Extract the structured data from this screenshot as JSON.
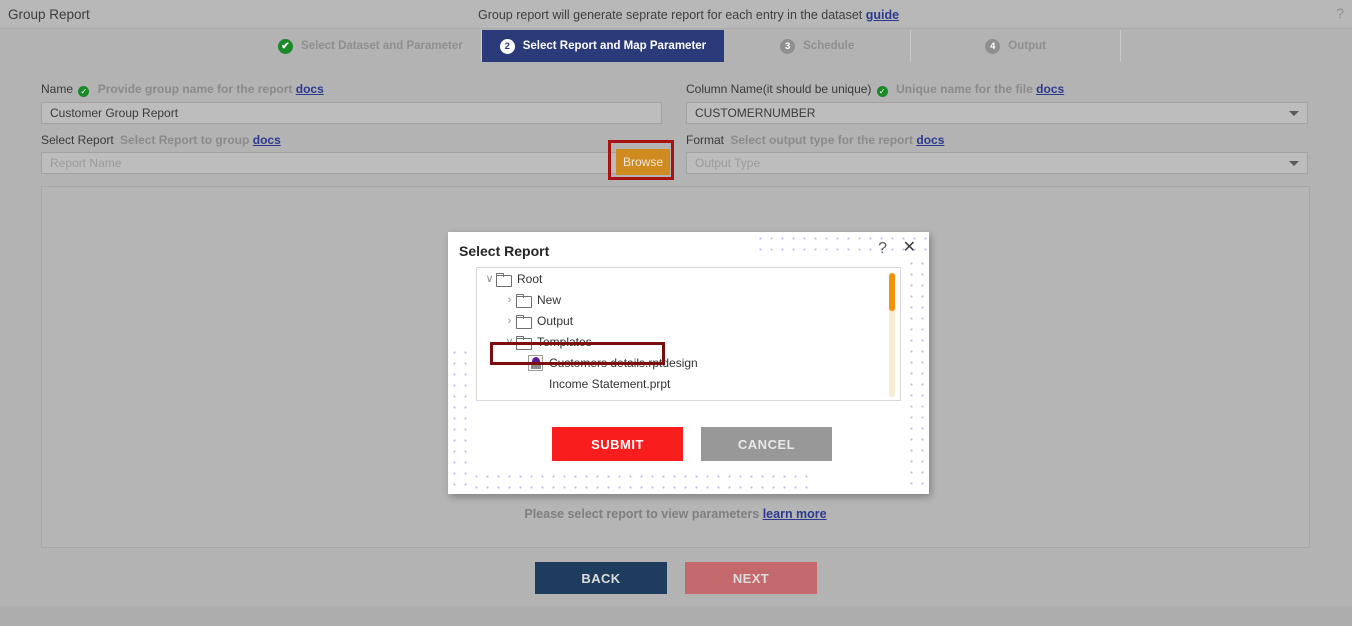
{
  "topbar": {
    "title": "Group Report",
    "center_text": "Group report will generate seprate report for each entry in the dataset",
    "center_link": "guide",
    "help_icon": "?"
  },
  "stepper": [
    {
      "badge": "✔",
      "label": "Select Dataset and Parameter",
      "state": "done"
    },
    {
      "badge": "2",
      "label": "Select Report and Map Parameter",
      "state": "active"
    },
    {
      "badge": "3",
      "label": "Schedule",
      "state": "idle"
    },
    {
      "badge": "4",
      "label": "Output",
      "state": "idle"
    }
  ],
  "form": {
    "name": {
      "label": "Name",
      "hint": "Provide group name for the report",
      "docs": "docs",
      "value": "Customer Group Report"
    },
    "select_report": {
      "label": "Select Report",
      "hint": "Select Report to group",
      "docs": "docs",
      "placeholder": "Report Name",
      "browse_label": "Browse"
    },
    "column_name": {
      "label": "Column Name(it should be unique)",
      "hint": "Unique name for the file",
      "docs": "docs",
      "value": "CUSTOMERNUMBER"
    },
    "format": {
      "label": "Format",
      "hint": "Select output type for the report",
      "docs": "docs",
      "placeholder": "Output Type"
    }
  },
  "panel": {
    "message": "Please select report to view parameters",
    "message_link": "learn more"
  },
  "nav": {
    "back_label": "BACK",
    "next_label": "NEXT"
  },
  "modal": {
    "title": "Select Report",
    "help_icon": "?",
    "close_icon": "✕",
    "tree": [
      {
        "label": "Root",
        "type": "folder",
        "chevron": "∨",
        "indent": 0
      },
      {
        "label": "New",
        "type": "folder",
        "chevron": "›",
        "indent": 1
      },
      {
        "label": "Output",
        "type": "folder",
        "chevron": "›",
        "indent": 1
      },
      {
        "label": "Templates",
        "type": "folder",
        "chevron": "∨",
        "indent": 1
      },
      {
        "label": "Customers details.rptdesign",
        "type": "report",
        "chevron": "",
        "indent": 2
      },
      {
        "label": "Income Statement.prpt",
        "type": "file",
        "chevron": "",
        "indent": 2
      }
    ],
    "submit_label": "SUBMIT",
    "cancel_label": "CANCEL"
  },
  "colors": {
    "active_step": "#2b3a78",
    "browse": "#cf8b1f",
    "submit": "#fa1d1d",
    "cancel": "#989898",
    "back": "#1d3c5e",
    "next": "#c4696b",
    "annotation": "#aa1111",
    "scroll_thumb": "#f59009",
    "link": "#2b3a8f"
  }
}
